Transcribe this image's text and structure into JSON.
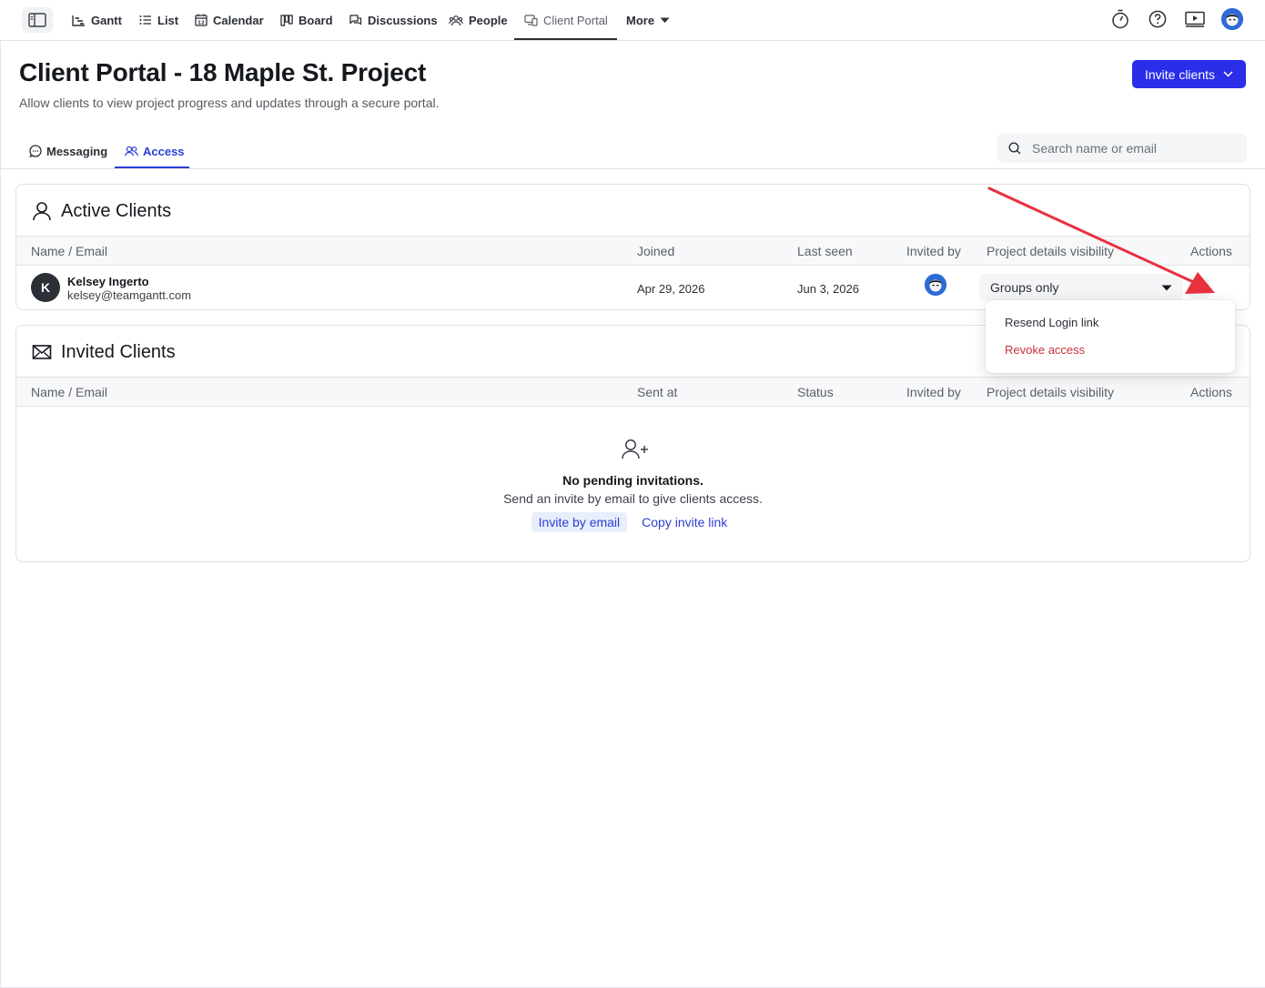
{
  "nav": {
    "items": [
      {
        "label": "Gantt",
        "icon": "gantt-icon"
      },
      {
        "label": "List",
        "icon": "list-icon"
      },
      {
        "label": "Calendar",
        "icon": "calendar-icon"
      },
      {
        "label": "Board",
        "icon": "board-icon"
      },
      {
        "label": "Discussions",
        "icon": "discussions-icon"
      },
      {
        "label": "People",
        "icon": "people-icon"
      },
      {
        "label": "Client Portal",
        "icon": "client-portal-icon"
      },
      {
        "label": "More",
        "icon": "caret-down-icon"
      }
    ],
    "active": "Client Portal",
    "right_icons": [
      "timer-icon",
      "help-icon",
      "video-icon",
      "user-avatar"
    ]
  },
  "header": {
    "title": "Client Portal - 18 Maple St. Project",
    "subtitle": "Allow clients to view project progress and updates through a secure portal.",
    "invite_button": "Invite clients"
  },
  "tabs": [
    {
      "label": "Messaging",
      "icon": "chat-icon"
    },
    {
      "label": "Access",
      "icon": "users-icon"
    }
  ],
  "active_tab": "Access",
  "search": {
    "placeholder": "Search name or email",
    "value": ""
  },
  "active_clients": {
    "title": "Active Clients",
    "columns": [
      "Name / Email",
      "Joined",
      "Last seen",
      "Invited by",
      "Project details visibility",
      "Actions"
    ],
    "rows": [
      {
        "initial": "K",
        "name": "Kelsey Ingerto",
        "email": "kelsey@teamgantt.com",
        "joined": "Apr 29, 2026",
        "last_seen": "Jun 3, 2026",
        "visibility": "Groups only"
      }
    ]
  },
  "invited_clients": {
    "title": "Invited Clients",
    "columns": [
      "Name / Email",
      "Sent at",
      "Status",
      "Invited by",
      "Project details visibility",
      "Actions"
    ],
    "empty_title": "No pending invitations.",
    "empty_text": "Send an invite by email to give clients access.",
    "invite_by_email": "Invite by email",
    "copy_invite_link": "Copy invite link"
  },
  "actions_menu": {
    "items": [
      "Resend Login link",
      "Revoke access"
    ],
    "danger_color": "#c8323f"
  },
  "colors": {
    "primary": "#2a2ee8",
    "link": "#2a3fd6",
    "annotation_arrow": "#e8303f"
  }
}
